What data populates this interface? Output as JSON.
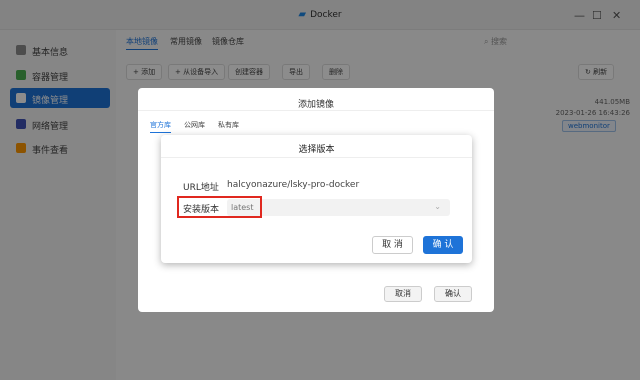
{
  "window": {
    "title": "Docker",
    "title_icon": "docker-whale-icon",
    "controls": [
      "—",
      "☐",
      "✕"
    ]
  },
  "sidebar": {
    "items": [
      {
        "label": "基本信息",
        "icon": "info-icon",
        "color": "#8c8c8c"
      },
      {
        "label": "容器管理",
        "icon": "container-icon",
        "color": "#4caf50"
      },
      {
        "label": "镜像管理",
        "icon": "image-icon",
        "color": "#ffffff",
        "active": true
      },
      {
        "label": "网络管理",
        "icon": "network-icon",
        "color": "#3f51b5"
      },
      {
        "label": "事件查看",
        "icon": "event-icon",
        "color": "#ff9800"
      }
    ]
  },
  "main": {
    "tabs": [
      {
        "label": "本地镜像",
        "active": true
      },
      {
        "label": "常用镜像"
      },
      {
        "label": "镜像仓库"
      }
    ],
    "search_placeholder": "搜索",
    "toolbar": [
      "+ 添加",
      "+ 从设备导入",
      "创建容器",
      "导出",
      "删除"
    ],
    "refresh_label": "刷新",
    "row": {
      "size": "441.05MB",
      "date": "2023-01-26 16:43:26",
      "tag": "webmonitor"
    }
  },
  "add_dialog": {
    "title": "添加镜像",
    "tabs": [
      {
        "label": "官方库",
        "active": true
      },
      {
        "label": "公网库"
      },
      {
        "label": "私有库"
      }
    ],
    "cancel_label": "取消",
    "ok_label": "确认"
  },
  "version_dialog": {
    "title": "选择版本",
    "url_label": "URL地址",
    "url_value": "halcyonazure/lsky-pro-docker",
    "version_label": "安装版本",
    "version_placeholder": "latest",
    "cancel_label": "取 消",
    "ok_label": "确 认",
    "highlight_color": "#e0281f",
    "accent": "#1e73d8"
  }
}
